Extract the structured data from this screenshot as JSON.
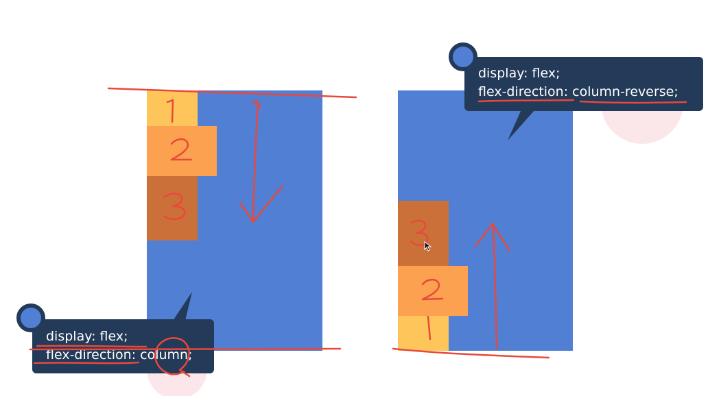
{
  "left_example": {
    "items": [
      {
        "number": "1",
        "color": "#fec65a"
      },
      {
        "number": "2",
        "color": "#fba14f"
      },
      {
        "number": "3",
        "color": "#cc703a"
      }
    ],
    "code": {
      "line1": "display: flex;",
      "line2": "flex-direction: column;"
    },
    "arrow": "down"
  },
  "right_example": {
    "items": [
      {
        "number": "3",
        "color": "#cc703a"
      },
      {
        "number": "2",
        "color": "#fba14f"
      },
      {
        "number": "1",
        "color": "#fec65a"
      }
    ],
    "code": {
      "line1": "display: flex;",
      "line2": "flex-direction: column-reverse;"
    },
    "arrow": "up"
  },
  "colors": {
    "container": "#507fd4",
    "tooltip": "#233a58",
    "annotation": "#e8493c",
    "item_1": "#fec65a",
    "item_2": "#fba14f",
    "item_3": "#cc703a"
  },
  "icons": {
    "cursor": "mouse-pointer-icon",
    "tooltip_dot": "circle-dot-icon"
  }
}
